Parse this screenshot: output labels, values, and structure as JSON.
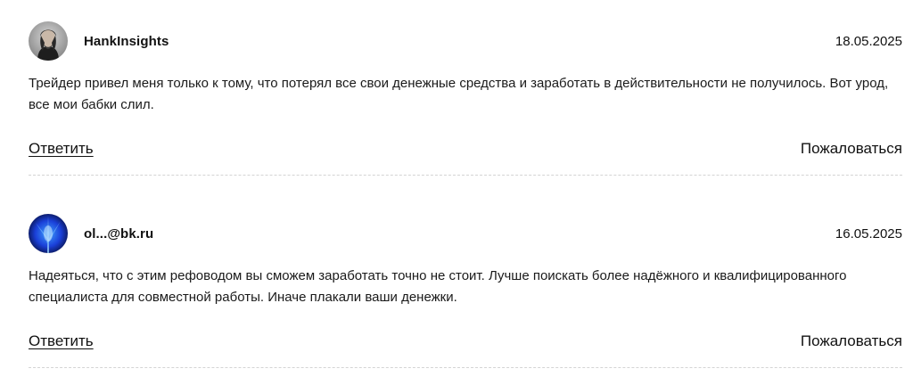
{
  "comments": [
    {
      "username": "HankInsights",
      "date": "18.05.2025",
      "text": "Трейдер привел меня только к тому, что потерял все свои денежные средства и заработать в действительности не получилось. Вот урод, все мои бабки слил.",
      "reply_label": "Ответить",
      "report_label": "Пожаловаться",
      "avatar_icon": "user-photo-icon"
    },
    {
      "username": "ol...@bk.ru",
      "date": "16.05.2025",
      "text": "Надеяться, что с этим рефоводом вы сможем заработать точно не стоит. Лучше поискать более надёжного и квалифицированного специалиста для совместной работы. Иначе плакали ваши денежки.",
      "reply_label": "Ответить",
      "report_label": "Пожаловаться",
      "avatar_icon": "user-photo-icon"
    }
  ]
}
